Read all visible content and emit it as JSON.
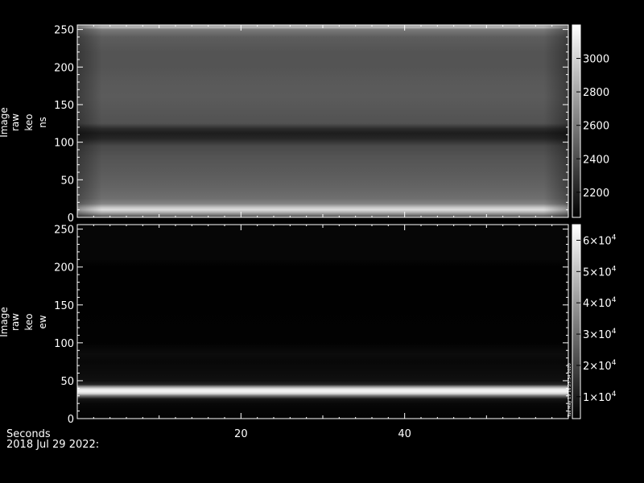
{
  "chart_data": [
    {
      "type": "heatmap",
      "ylabel": [
        "Image",
        "raw",
        "keo",
        "ns"
      ],
      "ylim": [
        0,
        256
      ],
      "yticks": [
        0,
        50,
        100,
        150,
        200,
        250
      ],
      "xlim": [
        0,
        60
      ],
      "colorbar": {
        "ticks": [
          2200,
          2400,
          2600,
          2800,
          3000
        ],
        "tick_labels": [
          "2200",
          "2400",
          "2600",
          "2800",
          "3000"
        ],
        "range": [
          2050,
          3200
        ]
      },
      "profile": {
        "rows": [
          0,
          6,
          10,
          13,
          18,
          25,
          40,
          60,
          80,
          95,
          105,
          112,
          118,
          125,
          140,
          160,
          180,
          200,
          220,
          240,
          250,
          253,
          256
        ],
        "values": [
          2350,
          2800,
          3050,
          2950,
          2650,
          2550,
          2500,
          2460,
          2430,
          2380,
          2220,
          2180,
          2250,
          2420,
          2440,
          2460,
          2450,
          2430,
          2430,
          2470,
          2600,
          2900,
          2700
        ]
      }
    },
    {
      "type": "heatmap",
      "ylabel": [
        "Image",
        "raw",
        "keo",
        "ew"
      ],
      "ylim": [
        0,
        256
      ],
      "yticks": [
        0,
        50,
        100,
        150,
        200,
        250
      ],
      "xlim": [
        0,
        60
      ],
      "colorbar": {
        "ticks": [
          10000,
          20000,
          30000,
          40000,
          50000,
          60000
        ],
        "tick_labels": [
          {
            "base": "1×10",
            "exp": "4"
          },
          {
            "base": "2×10",
            "exp": "4"
          },
          {
            "base": "3×10",
            "exp": "4"
          },
          {
            "base": "4×10",
            "exp": "4"
          },
          {
            "base": "5×10",
            "exp": "4"
          },
          {
            "base": "6×10",
            "exp": "4"
          }
        ],
        "range": [
          3000,
          65000
        ],
        "annotation": "Tue May 19 16:25:34 2020"
      },
      "profile": {
        "rows": [
          0,
          10,
          20,
          26,
          30,
          33,
          36,
          39,
          42,
          45,
          50,
          60,
          75,
          85,
          100,
          150,
          200,
          210,
          256
        ],
        "values": [
          3500,
          4000,
          5000,
          8000,
          30000,
          55000,
          62000,
          60000,
          40000,
          12000,
          7000,
          6000,
          5000,
          6000,
          3500,
          3300,
          3300,
          4500,
          4500
        ]
      }
    }
  ],
  "xaxis": {
    "ticks": [
      20,
      40
    ],
    "tick_labels": [
      "20",
      "40"
    ],
    "label": "Seconds"
  },
  "footer": {
    "date": "2018 Jul 29 2022:"
  }
}
